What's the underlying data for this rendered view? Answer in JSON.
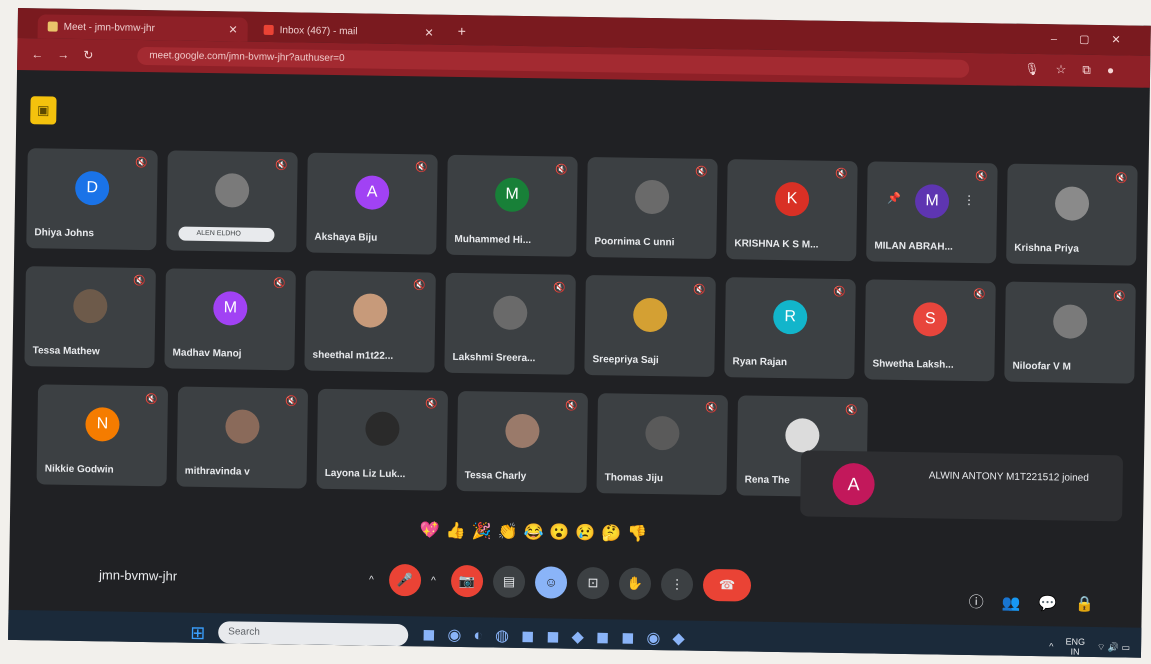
{
  "browser": {
    "tabs": [
      {
        "title": "Meet - jmn-bvmw-jhr",
        "active": true
      },
      {
        "title": "Inbox (467) - mail",
        "active": false
      }
    ],
    "url": "meet.google.com/jmn-bvmw-jhr?authuser=0"
  },
  "meeting": {
    "code": "jmn-bvmw-jhr",
    "participants": [
      {
        "name": "Dhiya Johns",
        "initial": "D",
        "color": "#1a73e8"
      },
      {
        "name": "ALEN ELDHO",
        "initial": "",
        "color": "#7a7a7a"
      },
      {
        "name": "Akshaya Biju",
        "initial": "A",
        "color": "#a142f4"
      },
      {
        "name": "Muhammed Hi...",
        "initial": "M",
        "color": "#188038"
      },
      {
        "name": "Poornima C unni",
        "initial": "",
        "color": "#6a6a6a"
      },
      {
        "name": "KRISHNA K S M...",
        "initial": "K",
        "color": "#d93025"
      },
      {
        "name": "MILAN ABRAH...",
        "initial": "M",
        "color": "#5e35b1"
      },
      {
        "name": "Krishna Priya",
        "initial": "",
        "color": "#8a8a8a"
      },
      {
        "name": "Tessa Mathew",
        "initial": "",
        "color": "#6d5a4a"
      },
      {
        "name": "Madhav Manoj",
        "initial": "M",
        "color": "#a142f4"
      },
      {
        "name": "sheethal m1t22...",
        "initial": "",
        "color": "#c79a7a"
      },
      {
        "name": "Lakshmi Sreera...",
        "initial": "",
        "color": "#6a6a6a"
      },
      {
        "name": "Sreepriya Saji",
        "initial": "",
        "color": "#d4a033"
      },
      {
        "name": "Ryan Rajan",
        "initial": "R",
        "color": "#12b5cb"
      },
      {
        "name": "Shwetha Laksh...",
        "initial": "S",
        "color": "#e8453c"
      },
      {
        "name": "Niloofar V M",
        "initial": "",
        "color": "#7a7a7a"
      },
      {
        "name": "Nikkie Godwin",
        "initial": "N",
        "color": "#f57c00"
      },
      {
        "name": "mithravinda v",
        "initial": "",
        "color": "#8a6a5a"
      },
      {
        "name": "Layona Liz Luk...",
        "initial": "",
        "color": "#2a2a2a"
      },
      {
        "name": "Tessa Charly",
        "initial": "",
        "color": "#9a7a6a"
      },
      {
        "name": "Thomas Jiju",
        "initial": "",
        "color": "#5a5a5a"
      },
      {
        "name": "Rena The",
        "initial": "",
        "color": "#dcdcdc"
      }
    ],
    "toast": {
      "initial": "A",
      "message": "ALWIN ANTONY M1T221512 joined"
    },
    "reactions": [
      "💖",
      "👍",
      "🎉",
      "👏",
      "😂",
      "😮",
      "😢",
      "🤔",
      "👎"
    ]
  },
  "controls": {
    "mic": "🎤",
    "camera": "📷",
    "captions": "▤",
    "emoji": "☺",
    "present": "⊡",
    "raise_hand": "✋",
    "more": "⋮",
    "end_call": "☎"
  },
  "side_controls": [
    "ⓘ",
    "👥",
    "💬",
    "🔒"
  ],
  "taskbar": {
    "search_placeholder": "Search",
    "lang_top": "ENG",
    "lang_bottom": "IN"
  }
}
